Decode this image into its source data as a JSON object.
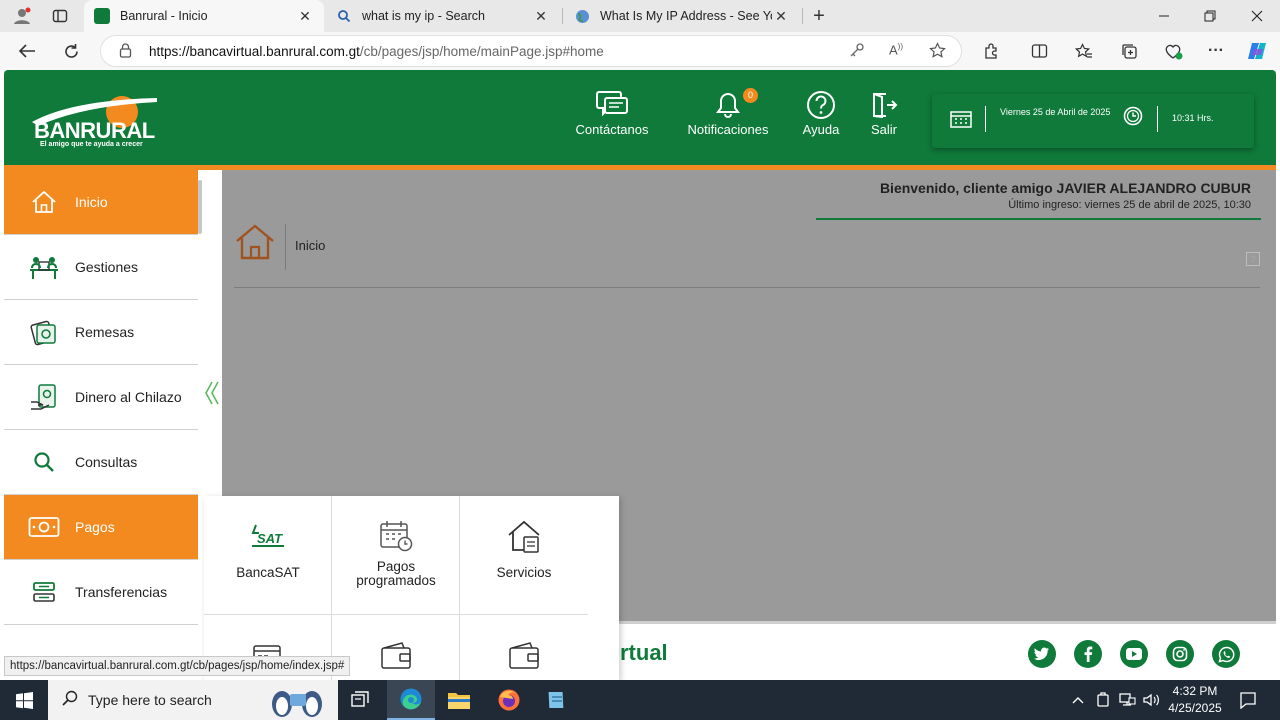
{
  "browser": {
    "tabs": [
      {
        "title": "Banrural - Inicio",
        "active": true
      },
      {
        "title": "what is my ip - Search",
        "active": false
      },
      {
        "title": "What Is My IP Address - See Your",
        "active": false
      }
    ],
    "url_host": "https://bancavirtual.banrural.com.gt",
    "url_path": "/cb/pages/jsp/home/mainPage.jsp#home"
  },
  "header": {
    "logo_name": "BANRURAL",
    "logo_tagline": "El amigo que te ayuda a crecer",
    "nav": [
      {
        "label": "Contáctanos",
        "icon": "chat-icon"
      },
      {
        "label": "Notificaciones",
        "icon": "bell-icon",
        "badge": "0"
      },
      {
        "label": "Ayuda",
        "icon": "help-icon"
      },
      {
        "label": "Salir",
        "icon": "exit-icon"
      }
    ],
    "date_text": "Viernes 25 de Abril de 2025",
    "time_text": "10:31 Hrs."
  },
  "sidebar": {
    "items": [
      {
        "label": "Inicio",
        "icon": "home-icon",
        "active": true
      },
      {
        "label": "Gestiones",
        "icon": "desk-icon"
      },
      {
        "label": "Remesas",
        "icon": "money-icon"
      },
      {
        "label": "Dinero al Chilazo",
        "icon": "cash-hand-icon"
      },
      {
        "label": "Consultas",
        "icon": "search-icon"
      },
      {
        "label": "Pagos",
        "icon": "banknote-icon",
        "active": true
      },
      {
        "label": "Transferencias",
        "icon": "transfer-icon"
      }
    ]
  },
  "content": {
    "welcome_line": "Bienvenido, cliente amigo JAVIER ALEJANDRO CUBUR",
    "last_login": "Último ingreso: viernes 25 de abril de 2025, 10:30",
    "breadcrumb": "Inicio",
    "help_mark": "?"
  },
  "pagos_menu": {
    "items": [
      {
        "label": "BancaSAT",
        "icon": "sat-icon"
      },
      {
        "label": "Pagos programados",
        "icon": "calendar-clock-icon"
      },
      {
        "label": "Servicios",
        "icon": "house-bill-icon"
      }
    ]
  },
  "footer": {
    "logo_text": "rtual"
  },
  "status_url": "https://bancavirtual.banrural.com.gt/cb/pages/jsp/home/index.jsp#",
  "taskbar": {
    "search_placeholder": "Type here to search",
    "time": "4:32 PM",
    "date": "4/25/2025"
  },
  "colors": {
    "brand_green": "#0f7a3a",
    "brand_orange": "#f28a1f"
  }
}
